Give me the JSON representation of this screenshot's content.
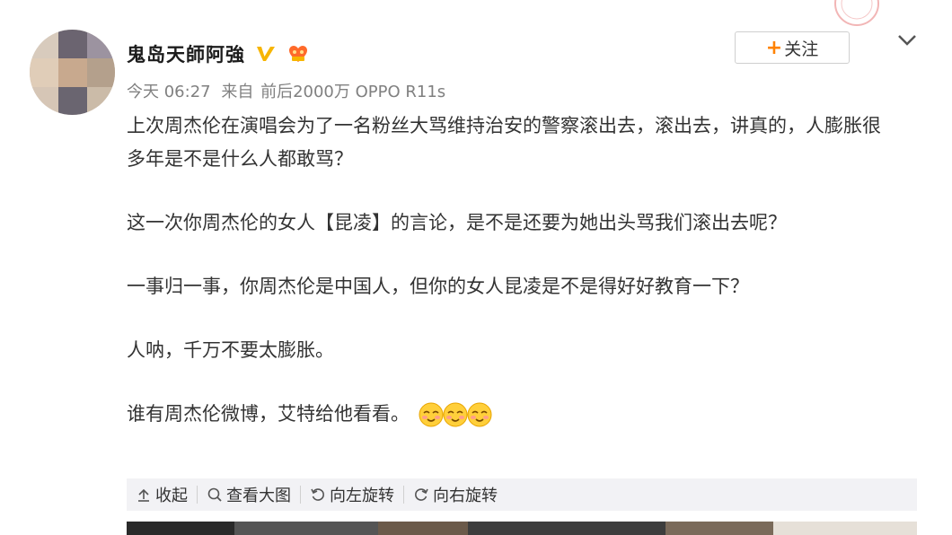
{
  "post": {
    "username": "鬼岛天師阿強",
    "verified_icon": "verified-v-icon",
    "fan_icon": "fan-badge-icon",
    "follow_label": "关注",
    "follow_plus": "+",
    "more_icon": "chevron-down-icon",
    "meta": {
      "time": "今天 06:27",
      "from_prefix": "来自",
      "source": "前后2000万 OPPO R11s"
    },
    "paragraphs": [
      "上次周杰伦在演唱会为了一名粉丝大骂维持治安的警察滚出去，滚出去，讲真的，人膨胀很多年是不是什么人都敢骂？",
      "这一次你周杰伦的女人【昆凌】的言论，是不是还要为她出头骂我们滚出去呢？",
      "一事归一事，你周杰伦是中国人，但你的女人昆凌是不是得好好教育一下？",
      "人呐，千万不要太膨胀。",
      "谁有周杰伦微博，艾特给他看看。"
    ],
    "emoji_icon": "smile-emoji-icon"
  },
  "toolbar": {
    "collapse_label": "收起",
    "view_large_label": "查看大图",
    "rotate_left_label": "向左旋转",
    "rotate_right_label": "向右旋转"
  },
  "colors": {
    "accent": "#ff8200",
    "text": "#333333",
    "meta": "#808080",
    "toolbar_bg": "#f2f2f5"
  }
}
